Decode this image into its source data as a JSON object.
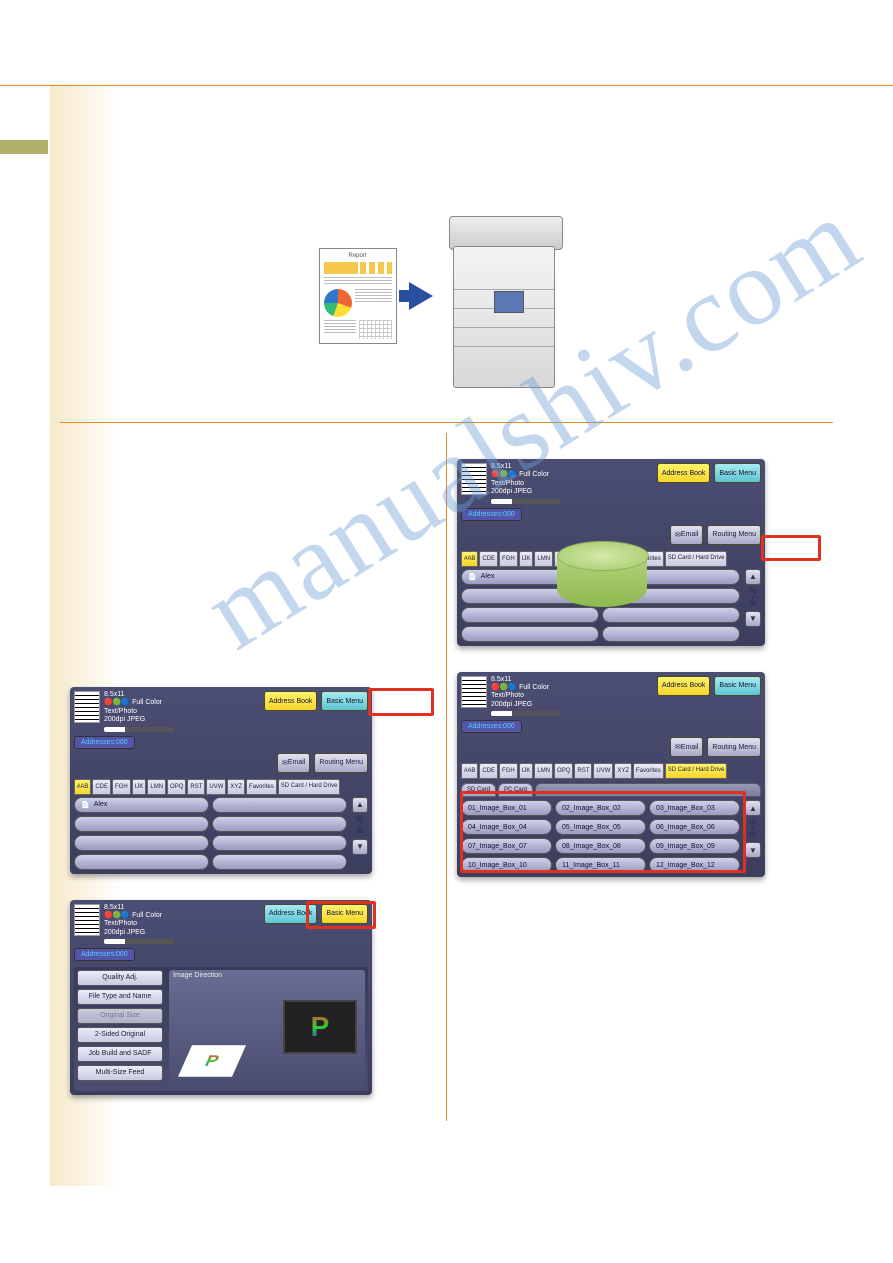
{
  "watermark": "manualshiv.com",
  "report_label": "Report",
  "scroll": {
    "page": "01",
    "sep": "/",
    "total": "01"
  },
  "panel_common": {
    "size": "8.5x11",
    "color": "Full Color",
    "mode": "Text/Photo",
    "res": "200dpi JPEG",
    "addresses": "Addresses:000",
    "address_book": "Address Book",
    "basic_menu": "Basic Menu",
    "email": "Email",
    "routing": "Routing Menu",
    "sdcard_hd": "SD Card / Hard Drive",
    "favorites": "Favorites",
    "tabs": [
      "#AB",
      "CDE",
      "FGH",
      "IJK",
      "LMN",
      "OPQ",
      "RST",
      "UVW",
      "XYZ"
    ],
    "contact": "Alex"
  },
  "basic_menu_panel": {
    "image_direction": "Image Direction",
    "options": [
      "Quality Adj.",
      "File Type and Name",
      "Original Size",
      "2-Sided Original",
      "Job Build and SADF",
      "Multi-Size Feed"
    ]
  },
  "sd_panel": {
    "sd_tab": "SD Card",
    "pc_tab": "PC Card",
    "boxes": [
      "01_Image_Box_01",
      "02_Image_Box_02",
      "03_Image_Box_03",
      "04_Image_Box_04",
      "05_Image_Box_05",
      "06_Image_Box_06",
      "07_Image_Box_07",
      "08_Image_Box_08",
      "09_Image_Box_09",
      "10_Image_Box_10",
      "11_Image_Box_11",
      "12_Image_Box_12"
    ]
  }
}
